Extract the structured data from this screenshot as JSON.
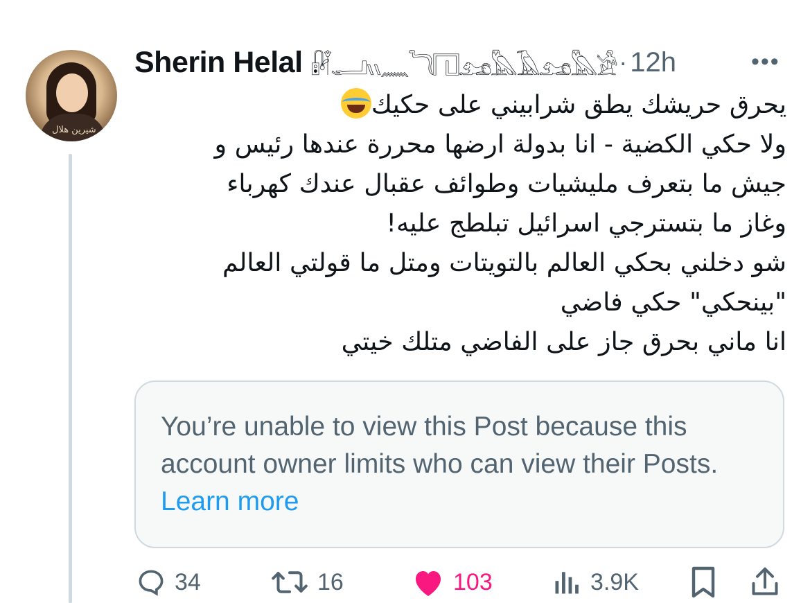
{
  "author": {
    "name": "Sherin Helal",
    "handle_glyphs": "𓏞𓂝𓏭𓈖𓆓𓉔𓃭𓅓𓄿𓃭𓅓𓀀",
    "separator": "·",
    "time": "12h",
    "avatar_signature": "شيرين هلال"
  },
  "tweet": {
    "lines": [
      "يحرق حريشك يطق شرابيني على حكيك",
      "ولا حكي الكضية - انا بدولة ارضها محررة عندها رئيس و",
      "جيش ما بتعرف مليشيات وطوائف عقبال عندك كهرباء",
      "وغاز ما بتسترجي اسرائيل تبلطج عليه!",
      "شو دخلني بحكي العالم بالتويتات ومتل ما قولتي العالم",
      "\"بينحكي\" حكي فاضي",
      "انا ماني بحرق جاز على الفاضي متلك خيتي"
    ],
    "emoji": "face-with-tears-of-joy"
  },
  "quoted_card": {
    "message": "You’re unable to view this Post because this account owner limits who can view their Posts.",
    "link": "Learn more"
  },
  "actions": {
    "replies": "34",
    "reposts": "16",
    "likes": "103",
    "views": "3.9K"
  },
  "colors": {
    "text": "#0f1419",
    "muted": "#536471",
    "like": "#f91880",
    "link": "#1d9bf0",
    "card_bg": "#f7f9f9",
    "border": "#cfd9de"
  }
}
